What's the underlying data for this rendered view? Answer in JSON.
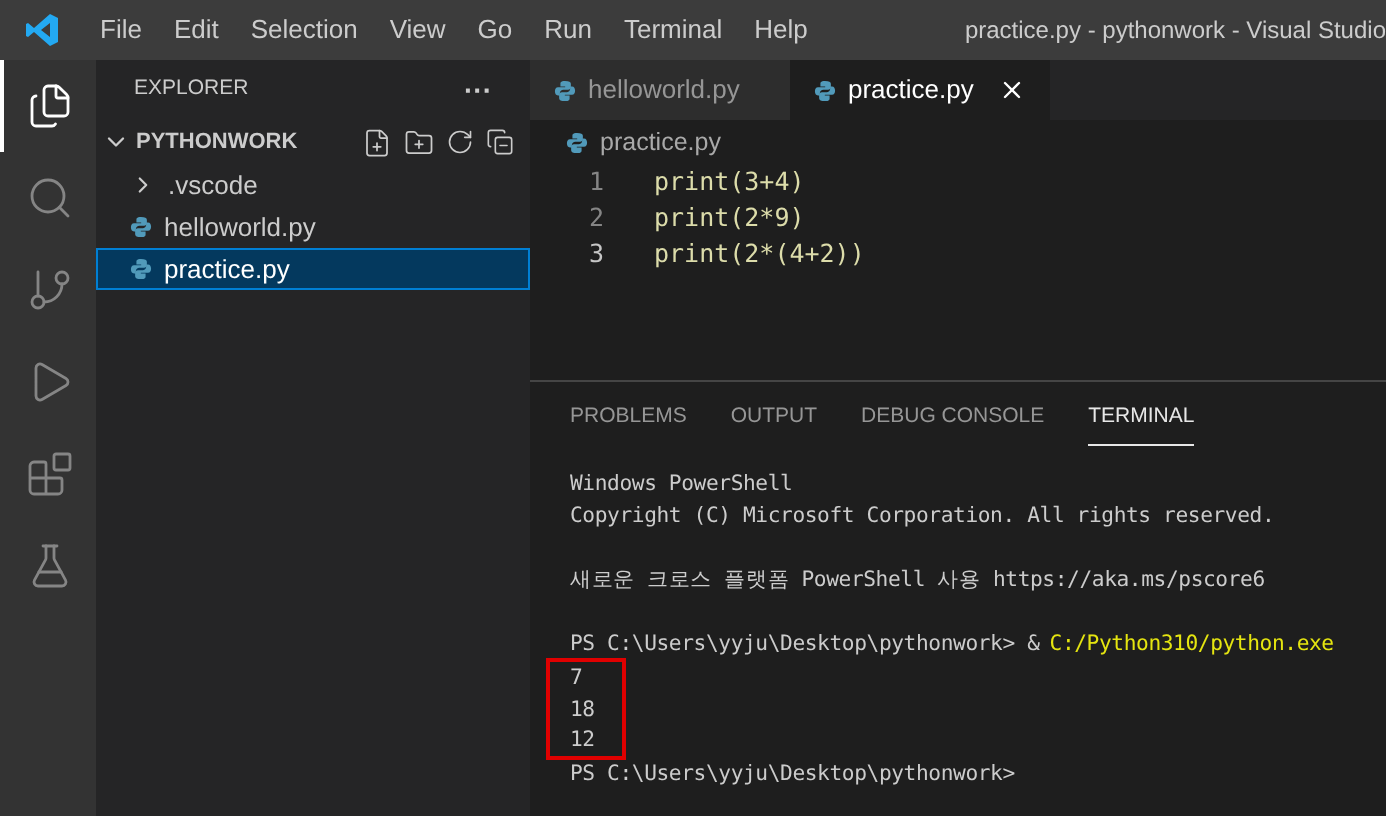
{
  "menu_bar": {
    "items": [
      "File",
      "Edit",
      "Selection",
      "View",
      "Go",
      "Run",
      "Terminal",
      "Help"
    ],
    "title": "practice.py - pythonwork - Visual Studio"
  },
  "activity_bar": [
    {
      "kind": "explorer",
      "selected": true
    },
    {
      "kind": "search",
      "selected": false
    },
    {
      "kind": "source-control",
      "selected": false
    },
    {
      "kind": "run-debug",
      "selected": false
    },
    {
      "kind": "extensions",
      "selected": false
    },
    {
      "kind": "testing",
      "selected": false
    }
  ],
  "sidebar": {
    "title": "EXPLORER",
    "more": "···",
    "folder": {
      "label": "PYTHONWORK",
      "expanded": true,
      "children": [
        {
          "label": ".vscode",
          "kind": "folder",
          "expanded": false,
          "selected": false
        },
        {
          "label": "helloworld.py",
          "kind": "python",
          "selected": false
        },
        {
          "label": "practice.py",
          "kind": "python",
          "selected": true
        }
      ]
    }
  },
  "tabs": [
    {
      "label": "helloworld.py",
      "selected": false
    },
    {
      "label": "practice.py",
      "selected": true
    }
  ],
  "breadcrumb": "practice.py",
  "code_lines": [
    {
      "number": "1",
      "text": "print(3+4)"
    },
    {
      "number": "2",
      "text": "print(2*9)"
    },
    {
      "number": "3",
      "text": "print(2*(4+2))"
    }
  ],
  "panel_tabs": [
    {
      "label": "PROBLEMS",
      "selected": false
    },
    {
      "label": "OUTPUT",
      "selected": false
    },
    {
      "label": "DEBUG CONSOLE",
      "selected": false
    },
    {
      "label": "TERMINAL",
      "selected": true
    }
  ],
  "terminal_lines": [
    {
      "kind": "text",
      "segments": [
        {
          "kind": "plain",
          "text": "Windows PowerShell"
        }
      ]
    },
    {
      "kind": "text",
      "segments": [
        {
          "kind": "plain",
          "text": "Copyright (C) Microsoft Corporation. All rights reserved."
        }
      ]
    },
    {
      "kind": "blank"
    },
    {
      "kind": "text",
      "segments": [
        {
          "kind": "plain",
          "text": "새로운 크로스 플랫폼 PowerShell 사용 https://aka.ms/pscore6"
        }
      ]
    },
    {
      "kind": "blank"
    },
    {
      "kind": "text",
      "segments": [
        {
          "kind": "plain",
          "text": "PS C:\\Users\\yyju\\Desktop\\pythonwork> &"
        },
        {
          "kind": "path",
          "text": "C:/Python310/python.exe"
        }
      ]
    }
  ],
  "highlighted_output": [
    "7",
    "18",
    "12"
  ],
  "final_prompt": "PS C:\\Users\\yyju\\Desktop\\pythonwork>"
}
